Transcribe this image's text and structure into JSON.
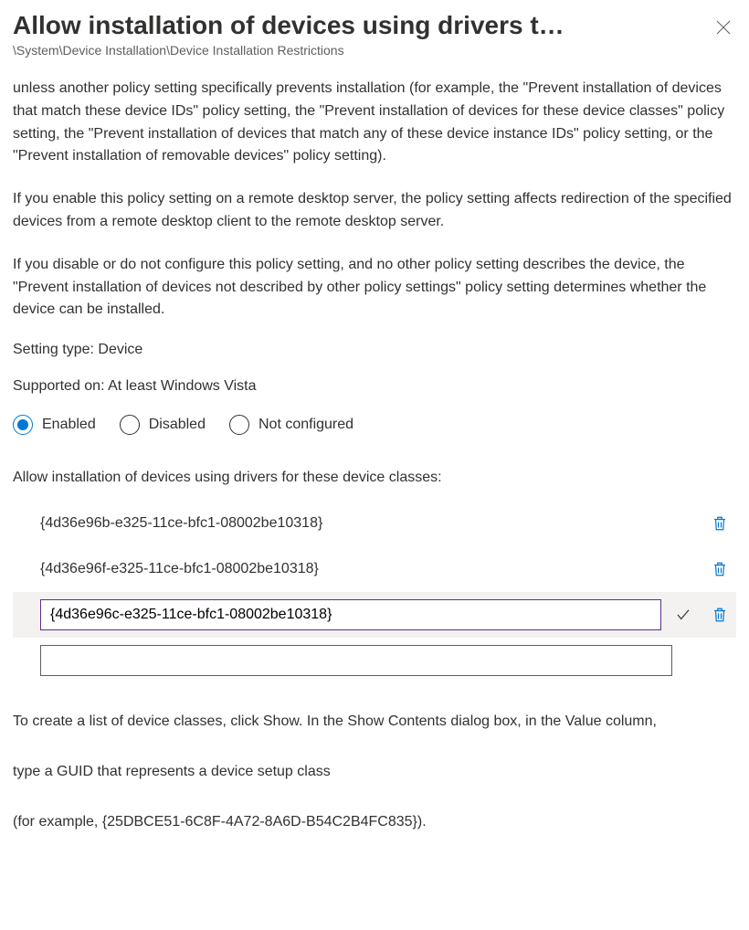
{
  "header": {
    "title": "Allow installation of devices using drivers t…",
    "breadcrumb": "\\System\\Device Installation\\Device Installation Restrictions"
  },
  "description": {
    "para1": "unless another policy setting specifically prevents installation (for example, the \"Prevent installation of devices that match these device IDs\" policy setting, the \"Prevent installation of devices for these device classes\" policy setting, the \"Prevent installation of devices that match any of these device instance IDs\" policy setting, or the \"Prevent installation of removable devices\" policy setting).",
    "para2": "If you enable this policy setting on a remote desktop server, the policy setting affects redirection of the specified devices from a remote desktop client to the remote desktop server.",
    "para3": "If you disable or do not configure this policy setting, and no other policy setting describes the device, the \"Prevent installation of devices not described by other policy settings\" policy setting determines whether the device can be installed."
  },
  "meta": {
    "setting_type": "Setting type: Device",
    "supported_on": "Supported on: At least Windows Vista"
  },
  "state": {
    "options": {
      "enabled": "Enabled",
      "disabled": "Disabled",
      "not_configured": "Not configured"
    },
    "selected": "enabled"
  },
  "device_classes": {
    "label": "Allow installation of devices using drivers for these device classes:",
    "rows": [
      {
        "value": "{4d36e96b-e325-11ce-bfc1-08002be10318}",
        "editing": false
      },
      {
        "value": "{4d36e96f-e325-11ce-bfc1-08002be10318}",
        "editing": false
      },
      {
        "value": "{4d36e96c-e325-11ce-bfc1-08002be10318}",
        "editing": true
      },
      {
        "value": "",
        "editing": false,
        "new": true
      }
    ]
  },
  "instructions": {
    "p1": "To create a list of device classes, click Show. In the Show Contents dialog box, in the Value column,",
    "p2": "type a GUID that represents a device setup class",
    "p3": "(for example, {25DBCE51-6C8F-4A72-8A6D-B54C2B4FC835})."
  }
}
